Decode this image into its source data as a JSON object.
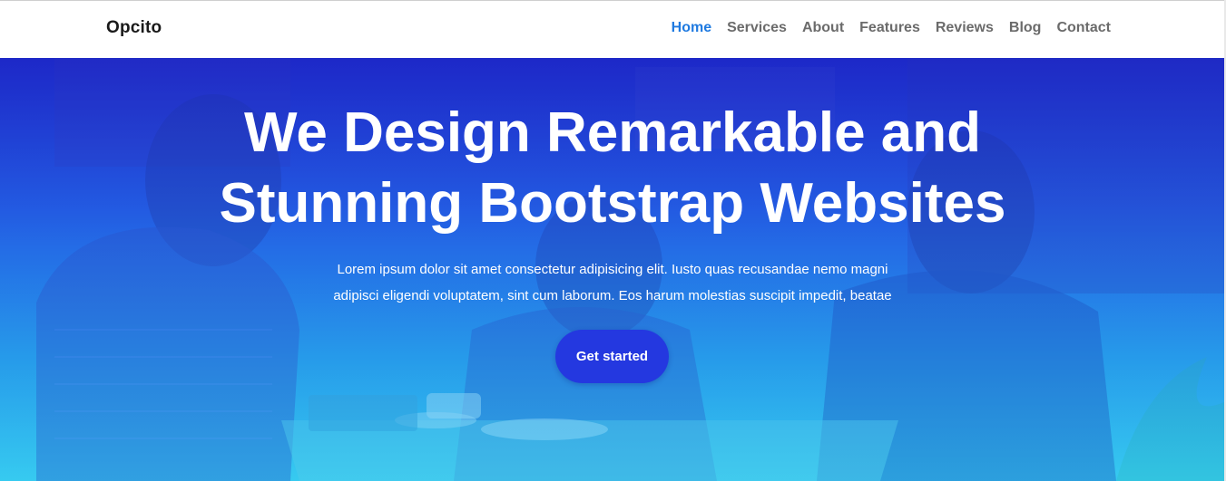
{
  "navbar": {
    "brand": "Opcito",
    "links": [
      {
        "label": "Home",
        "active": true
      },
      {
        "label": "Services",
        "active": false
      },
      {
        "label": "About",
        "active": false
      },
      {
        "label": "Features",
        "active": false
      },
      {
        "label": "Reviews",
        "active": false
      },
      {
        "label": "Blog",
        "active": false
      },
      {
        "label": "Contact",
        "active": false
      }
    ]
  },
  "hero": {
    "title_line1": "We Design Remarkable and",
    "title_line2": "Stunning Bootstrap Websites",
    "text_line1": "Lorem ipsum dolor sit amet consectetur adipisicing elit. Iusto quas recusandae nemo magni",
    "text_line2": "adipisci eligendi voluptatem, sint cum laborum. Eos harum molestias suscipit impedit, beatae",
    "cta_label": "Get started"
  },
  "colors": {
    "accent": "#1f7ae0",
    "nav_text": "#6b6b6b",
    "cta_background": "#2438e0",
    "hero_gradient_top": "#1f2fc8",
    "hero_gradient_bottom": "#3fd2f0"
  }
}
